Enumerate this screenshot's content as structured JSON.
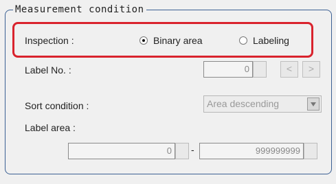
{
  "group": {
    "title": "Measurement condition"
  },
  "inspection": {
    "label": "Inspection :",
    "options": [
      {
        "label": "Binary area",
        "checked": true
      },
      {
        "label": "Labeling",
        "checked": false
      }
    ]
  },
  "label_no": {
    "label": "Label No. :",
    "value": "0",
    "prev": "<",
    "next": ">"
  },
  "sort": {
    "label": "Sort condition :",
    "value": "Area descending"
  },
  "label_area": {
    "label": "Label area :",
    "min": "0",
    "separator": "-",
    "max": "999999999"
  }
}
